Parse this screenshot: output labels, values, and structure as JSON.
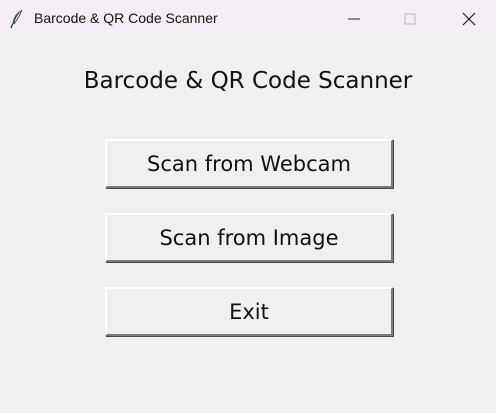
{
  "window": {
    "title": "Barcode & QR Code Scanner",
    "app_icon": "feather-icon",
    "controls": {
      "minimize_icon": "minimize-icon",
      "maximize_icon": "maximize-icon",
      "close_icon": "close-icon"
    }
  },
  "main": {
    "heading": "Barcode & QR Code Scanner",
    "buttons": {
      "scan_webcam": "Scan from Webcam",
      "scan_image": "Scan from Image",
      "exit": "Exit"
    }
  }
}
